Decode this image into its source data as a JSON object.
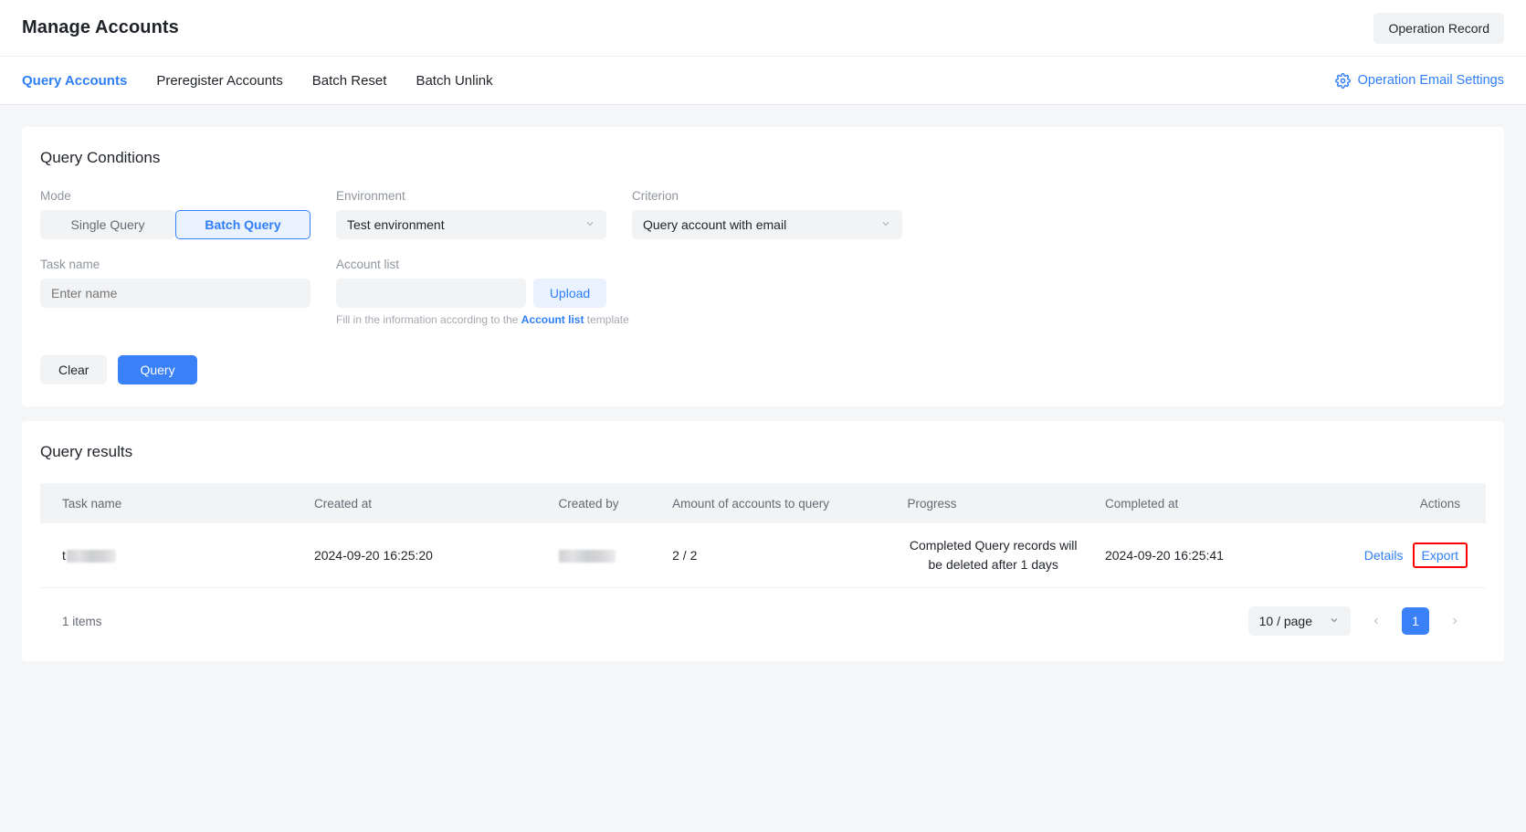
{
  "header": {
    "title": "Manage Accounts",
    "operation_record_label": "Operation Record"
  },
  "tabs": [
    {
      "label": "Query Accounts",
      "active": true
    },
    {
      "label": "Preregister Accounts",
      "active": false
    },
    {
      "label": "Batch Reset",
      "active": false
    },
    {
      "label": "Batch Unlink",
      "active": false
    }
  ],
  "email_settings": {
    "label": "Operation Email Settings",
    "icon": "gear-icon",
    "color": "#2f7ef6"
  },
  "query_conditions": {
    "title": "Query Conditions",
    "mode": {
      "label": "Mode",
      "options": [
        "Single Query",
        "Batch Query"
      ],
      "selected": "Batch Query"
    },
    "environment": {
      "label": "Environment",
      "value": "Test environment",
      "chevron": "chevron-down-icon"
    },
    "criterion": {
      "label": "Criterion",
      "value": "Query account with email",
      "chevron": "chevron-down-icon"
    },
    "task_name": {
      "label": "Task name",
      "placeholder": "Enter name",
      "value": ""
    },
    "account_list": {
      "label": "Account list",
      "placeholder": "",
      "value": "",
      "upload_label": "Upload",
      "hint_prefix": "Fill in the information according to the ",
      "hint_link": "Account list",
      "hint_suffix": " template"
    },
    "buttons": {
      "clear_label": "Clear",
      "query_label": "Query"
    }
  },
  "query_results": {
    "title": "Query results",
    "columns": [
      "Task name",
      "Created at",
      "Created by",
      "Amount of accounts to query",
      "Progress",
      "Completed at",
      "Actions"
    ],
    "rows": [
      {
        "task_name_visible": "t",
        "task_name_redacted": true,
        "created_at": "2024-09-20 16:25:20",
        "created_by_redacted": true,
        "amount": "2 / 2",
        "progress": "Completed Query records will be deleted after 1 days",
        "completed_at": "2024-09-20 16:25:41",
        "action_details": "Details",
        "action_export": "Export"
      }
    ],
    "pagination": {
      "items_text": "1 items",
      "page_size": "10 / page",
      "prev_icon": "chevron-left-icon",
      "next_icon": "chevron-right-icon",
      "current_page": "1"
    }
  },
  "highlight": {
    "target": "Export",
    "color": "#ff0000"
  }
}
